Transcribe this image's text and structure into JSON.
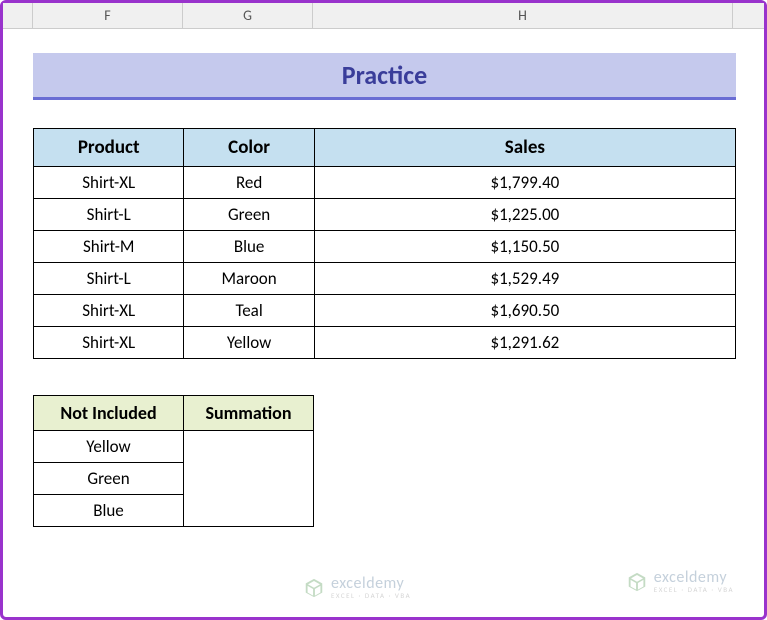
{
  "columns": {
    "f": "F",
    "g": "G",
    "h": "H"
  },
  "title": "Practice",
  "table": {
    "headers": {
      "product": "Product",
      "color": "Color",
      "sales": "Sales"
    },
    "rows": [
      {
        "product": "Shirt-XL",
        "color": "Red",
        "sales": "$1,799.40"
      },
      {
        "product": "Shirt-L",
        "color": "Green",
        "sales": "$1,225.00"
      },
      {
        "product": "Shirt-M",
        "color": "Blue",
        "sales": "$1,150.50"
      },
      {
        "product": "Shirt-L",
        "color": "Maroon",
        "sales": "$1,529.49"
      },
      {
        "product": "Shirt-XL",
        "color": "Teal",
        "sales": "$1,690.50"
      },
      {
        "product": "Shirt-XL",
        "color": "Yellow",
        "sales": "$1,291.62"
      }
    ]
  },
  "summary": {
    "headers": {
      "notinc": "Not Included",
      "sum": "Summation"
    },
    "rows": [
      {
        "notinc": "Yellow",
        "sum": ""
      },
      {
        "notinc": "Green",
        "sum": ""
      },
      {
        "notinc": "Blue",
        "sum": ""
      }
    ]
  },
  "watermark": {
    "name": "exceldemy",
    "tag": "EXCEL · DATA · VBA"
  }
}
